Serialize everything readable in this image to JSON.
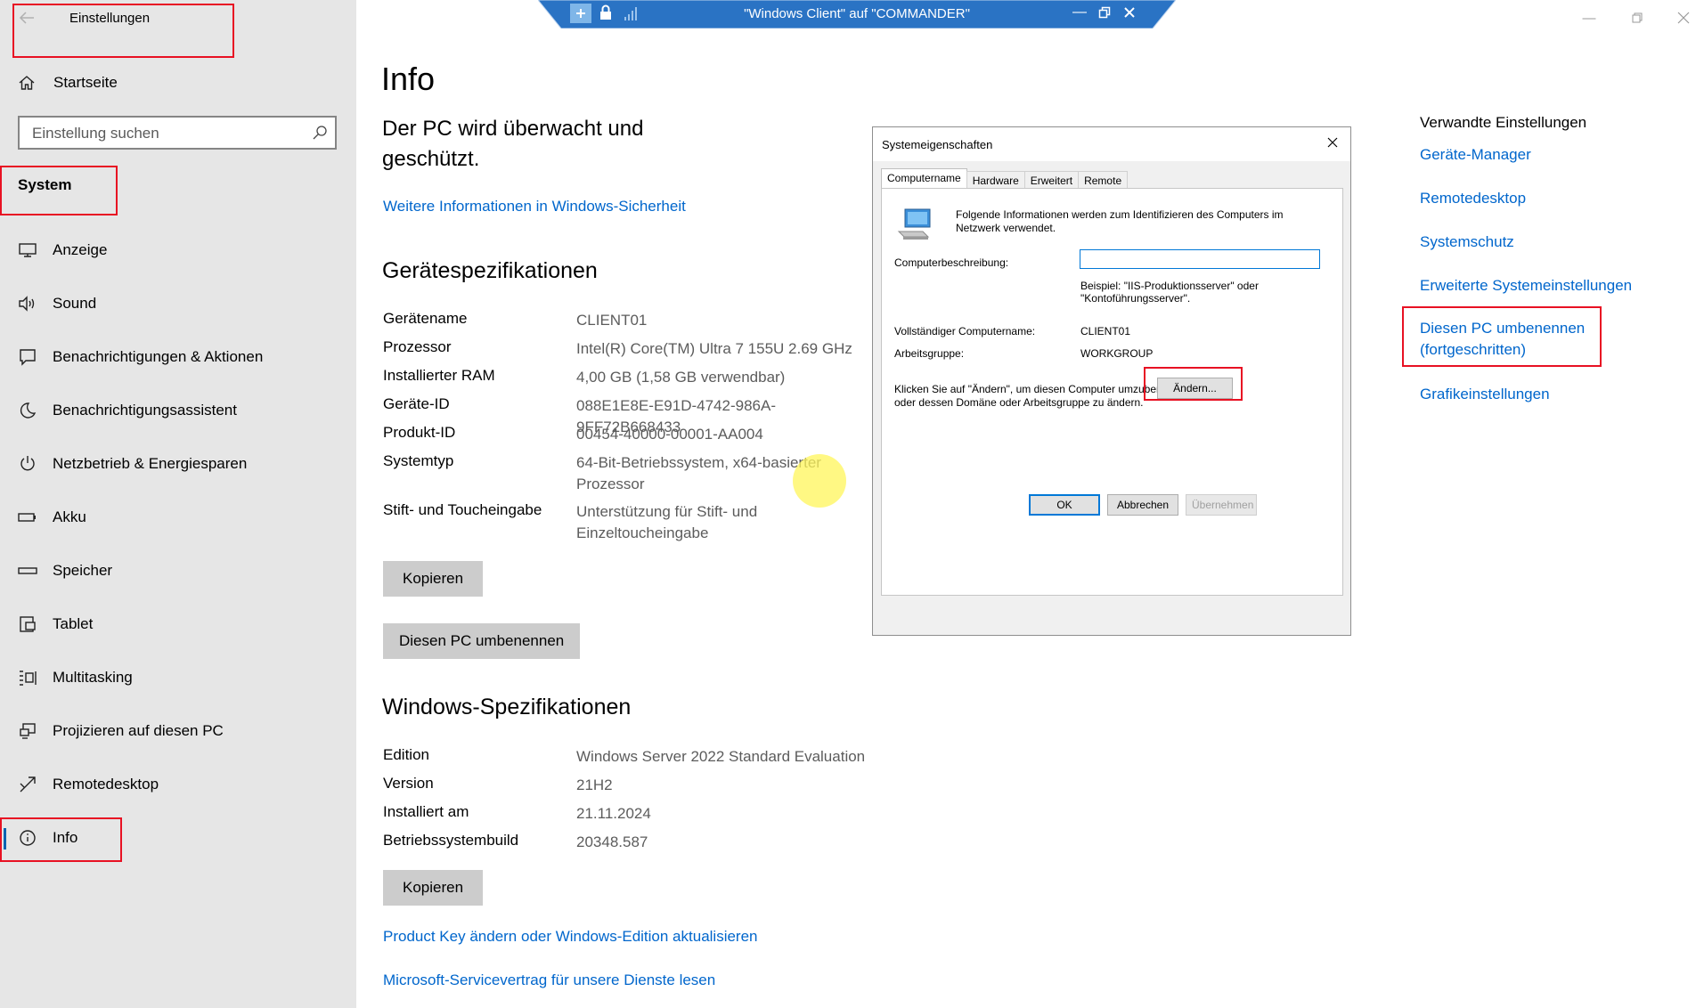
{
  "sidebar": {
    "window_title": "Einstellungen",
    "home": "Startseite",
    "search_placeholder": "Einstellung suchen",
    "section": "System",
    "items": [
      {
        "label": "Anzeige",
        "icon": "monitor-icon"
      },
      {
        "label": "Sound",
        "icon": "speaker-icon"
      },
      {
        "label": "Benachrichtigungen & Aktionen",
        "icon": "notification-icon"
      },
      {
        "label": "Benachrichtigungsassistent",
        "icon": "moon-icon"
      },
      {
        "label": "Netzbetrieb & Energiesparen",
        "icon": "power-icon"
      },
      {
        "label": "Akku",
        "icon": "battery-icon"
      },
      {
        "label": "Speicher",
        "icon": "storage-icon"
      },
      {
        "label": "Tablet",
        "icon": "tablet-icon"
      },
      {
        "label": "Multitasking",
        "icon": "multitasking-icon"
      },
      {
        "label": "Projizieren auf diesen PC",
        "icon": "project-icon"
      },
      {
        "label": "Remotedesktop",
        "icon": "remote-icon"
      },
      {
        "label": "Info",
        "icon": "info-icon"
      }
    ]
  },
  "rdp_bar": {
    "title": "\"Windows Client\" auf \"COMMANDER\""
  },
  "main": {
    "title": "Info",
    "protect_text": "Der PC wird überwacht und geschützt.",
    "security_link": "Weitere Informationen in Windows-Sicherheit",
    "device_specs_title": "Gerätespezifikationen",
    "device_specs": [
      {
        "key": "Gerätename",
        "value": "CLIENT01"
      },
      {
        "key": "Prozessor",
        "value": "Intel(R) Core(TM) Ultra 7 155U   2.69 GHz"
      },
      {
        "key": "Installierter RAM",
        "value": "4,00 GB (1,58 GB verwendbar)"
      },
      {
        "key": "Geräte-ID",
        "value": "088E1E8E-E91D-4742-986A-9FF72B668433"
      },
      {
        "key": "Produkt-ID",
        "value": "00454-40000-00001-AA004"
      },
      {
        "key": "Systemtyp",
        "value": "64-Bit-Betriebssystem, x64-basierter Prozessor"
      },
      {
        "key": "Stift- und Toucheingabe",
        "value": "Unterstützung für Stift- und Einzeltoucheingabe"
      }
    ],
    "copy_button": "Kopieren",
    "rename_button": "Diesen PC umbenennen",
    "windows_specs_title": "Windows-Spezifikationen",
    "windows_specs": [
      {
        "key": "Edition",
        "value": "Windows Server 2022 Standard Evaluation"
      },
      {
        "key": "Version",
        "value": "21H2"
      },
      {
        "key": "Installiert am",
        "value": "21.11.2024"
      },
      {
        "key": "Betriebssystembuild",
        "value": "20348.587"
      }
    ],
    "copy_button_2": "Kopieren",
    "product_key_link": "Product Key ändern oder Windows-Edition aktualisieren",
    "service_link": "Microsoft-Servicevertrag für unsere Dienste lesen"
  },
  "related": {
    "title": "Verwandte Einstellungen",
    "links": [
      "Geräte-Manager",
      "Remotedesktop",
      "Systemschutz",
      "Erweiterte Systemeinstellungen",
      "Diesen PC umbenennen (fortgeschritten)",
      "Grafikeinstellungen"
    ]
  },
  "dialog": {
    "title": "Systemeigenschaften",
    "tabs": [
      "Computername",
      "Hardware",
      "Erweitert",
      "Remote"
    ],
    "info_text": "Folgende Informationen werden zum Identifizieren des Computers im Netzwerk verwendet.",
    "desc_label": "Computerbeschreibung:",
    "desc_value": "",
    "example": "Beispiel: \"IIS-Produktionsserver\" oder \"Kontoführungsserver\".",
    "fullname_label": "Vollständiger Computername:",
    "fullname_value": "CLIENT01",
    "workgroup_label": "Arbeitsgruppe:",
    "workgroup_value": "WORKGROUP",
    "change_text": "Klicken Sie auf \"Ändern\", um diesen Computer umzubenennen oder dessen Domäne oder Arbeitsgruppe zu ändern.",
    "change_button": "Ändern...",
    "ok": "OK",
    "cancel": "Abbrechen",
    "apply": "Übernehmen"
  },
  "colors": {
    "link": "#0066cc",
    "highlight": "#e81123",
    "rdp_bar": "#2a73c4"
  }
}
